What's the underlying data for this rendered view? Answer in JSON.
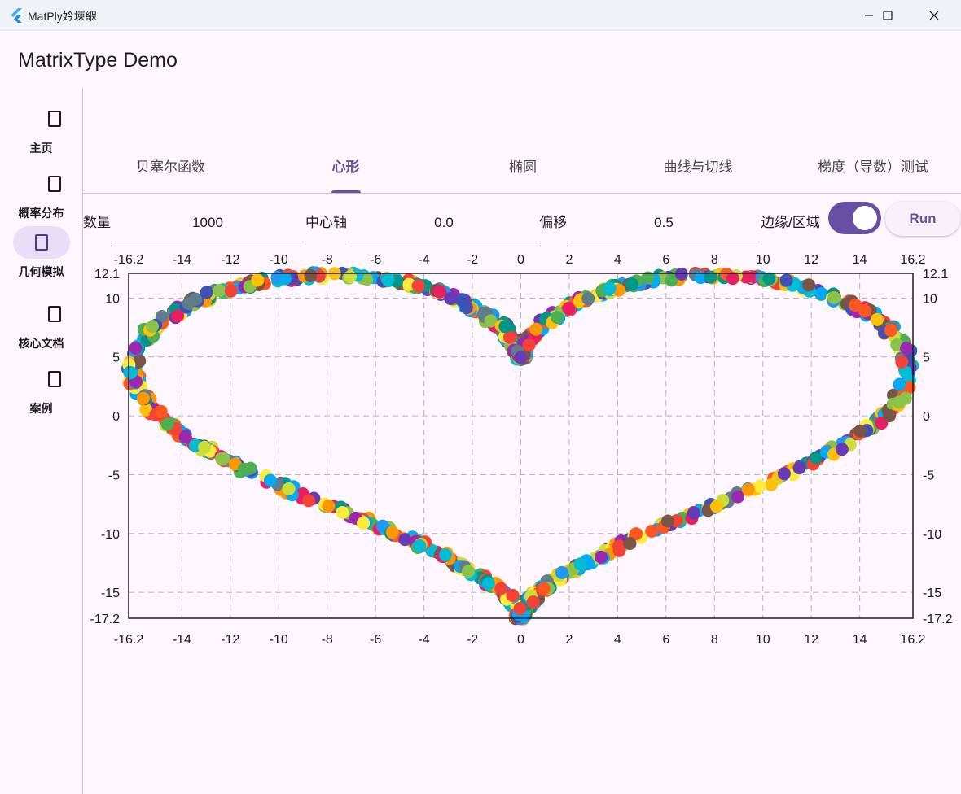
{
  "window": {
    "title": "MatPly妗堜緥"
  },
  "app": {
    "title": "MatrixType Demo"
  },
  "nav": {
    "items": [
      {
        "label": "主页",
        "icon": "home-icon"
      },
      {
        "label": "概率分布",
        "icon": "distribution-icon"
      },
      {
        "label": "几何模拟",
        "icon": "geometry-icon",
        "active": true
      },
      {
        "label": "核心文档",
        "icon": "document-icon"
      },
      {
        "label": "案例",
        "icon": "case-icon"
      }
    ]
  },
  "tabs": [
    {
      "label": "贝塞尔函数"
    },
    {
      "label": "心形",
      "active": true
    },
    {
      "label": "椭圆"
    },
    {
      "label": "曲线与切线"
    },
    {
      "label": "梯度（导数）测试"
    }
  ],
  "controls": {
    "count_label": "数量",
    "count_value": "1000",
    "axis_label": "中心轴",
    "axis_value": "0.0",
    "offset_label": "偏移",
    "offset_value": "0.5",
    "edge_label": "边缘/区域",
    "edge_on": true,
    "run_label": "Run"
  },
  "chart_data": {
    "type": "scatter",
    "shape": "heart",
    "n": 1000,
    "xlim": [
      -16.2,
      16.2
    ],
    "ylim": [
      -17.2,
      12.1
    ],
    "xticks": [
      "-16.2",
      "-14",
      "-12",
      "-10",
      "-8",
      "-6",
      "-4",
      "-2",
      "0",
      "2",
      "4",
      "6",
      "8",
      "10",
      "12",
      "14",
      "16.2"
    ],
    "yticks": [
      "12.1",
      "10",
      "5",
      "0",
      "-5",
      "-10",
      "-15",
      "-17.2"
    ],
    "grid": true,
    "colors": [
      "#4caf50",
      "#2196f3",
      "#e91e63",
      "#ff9800",
      "#9c27b0",
      "#00bcd4",
      "#ffeb3b",
      "#795548",
      "#607d8b",
      "#3f51b5",
      "#8bc34a",
      "#ff5722",
      "#009688",
      "#673ab7",
      "#cddc39",
      "#03a9f4",
      "#ffc107",
      "#f44336"
    ]
  }
}
